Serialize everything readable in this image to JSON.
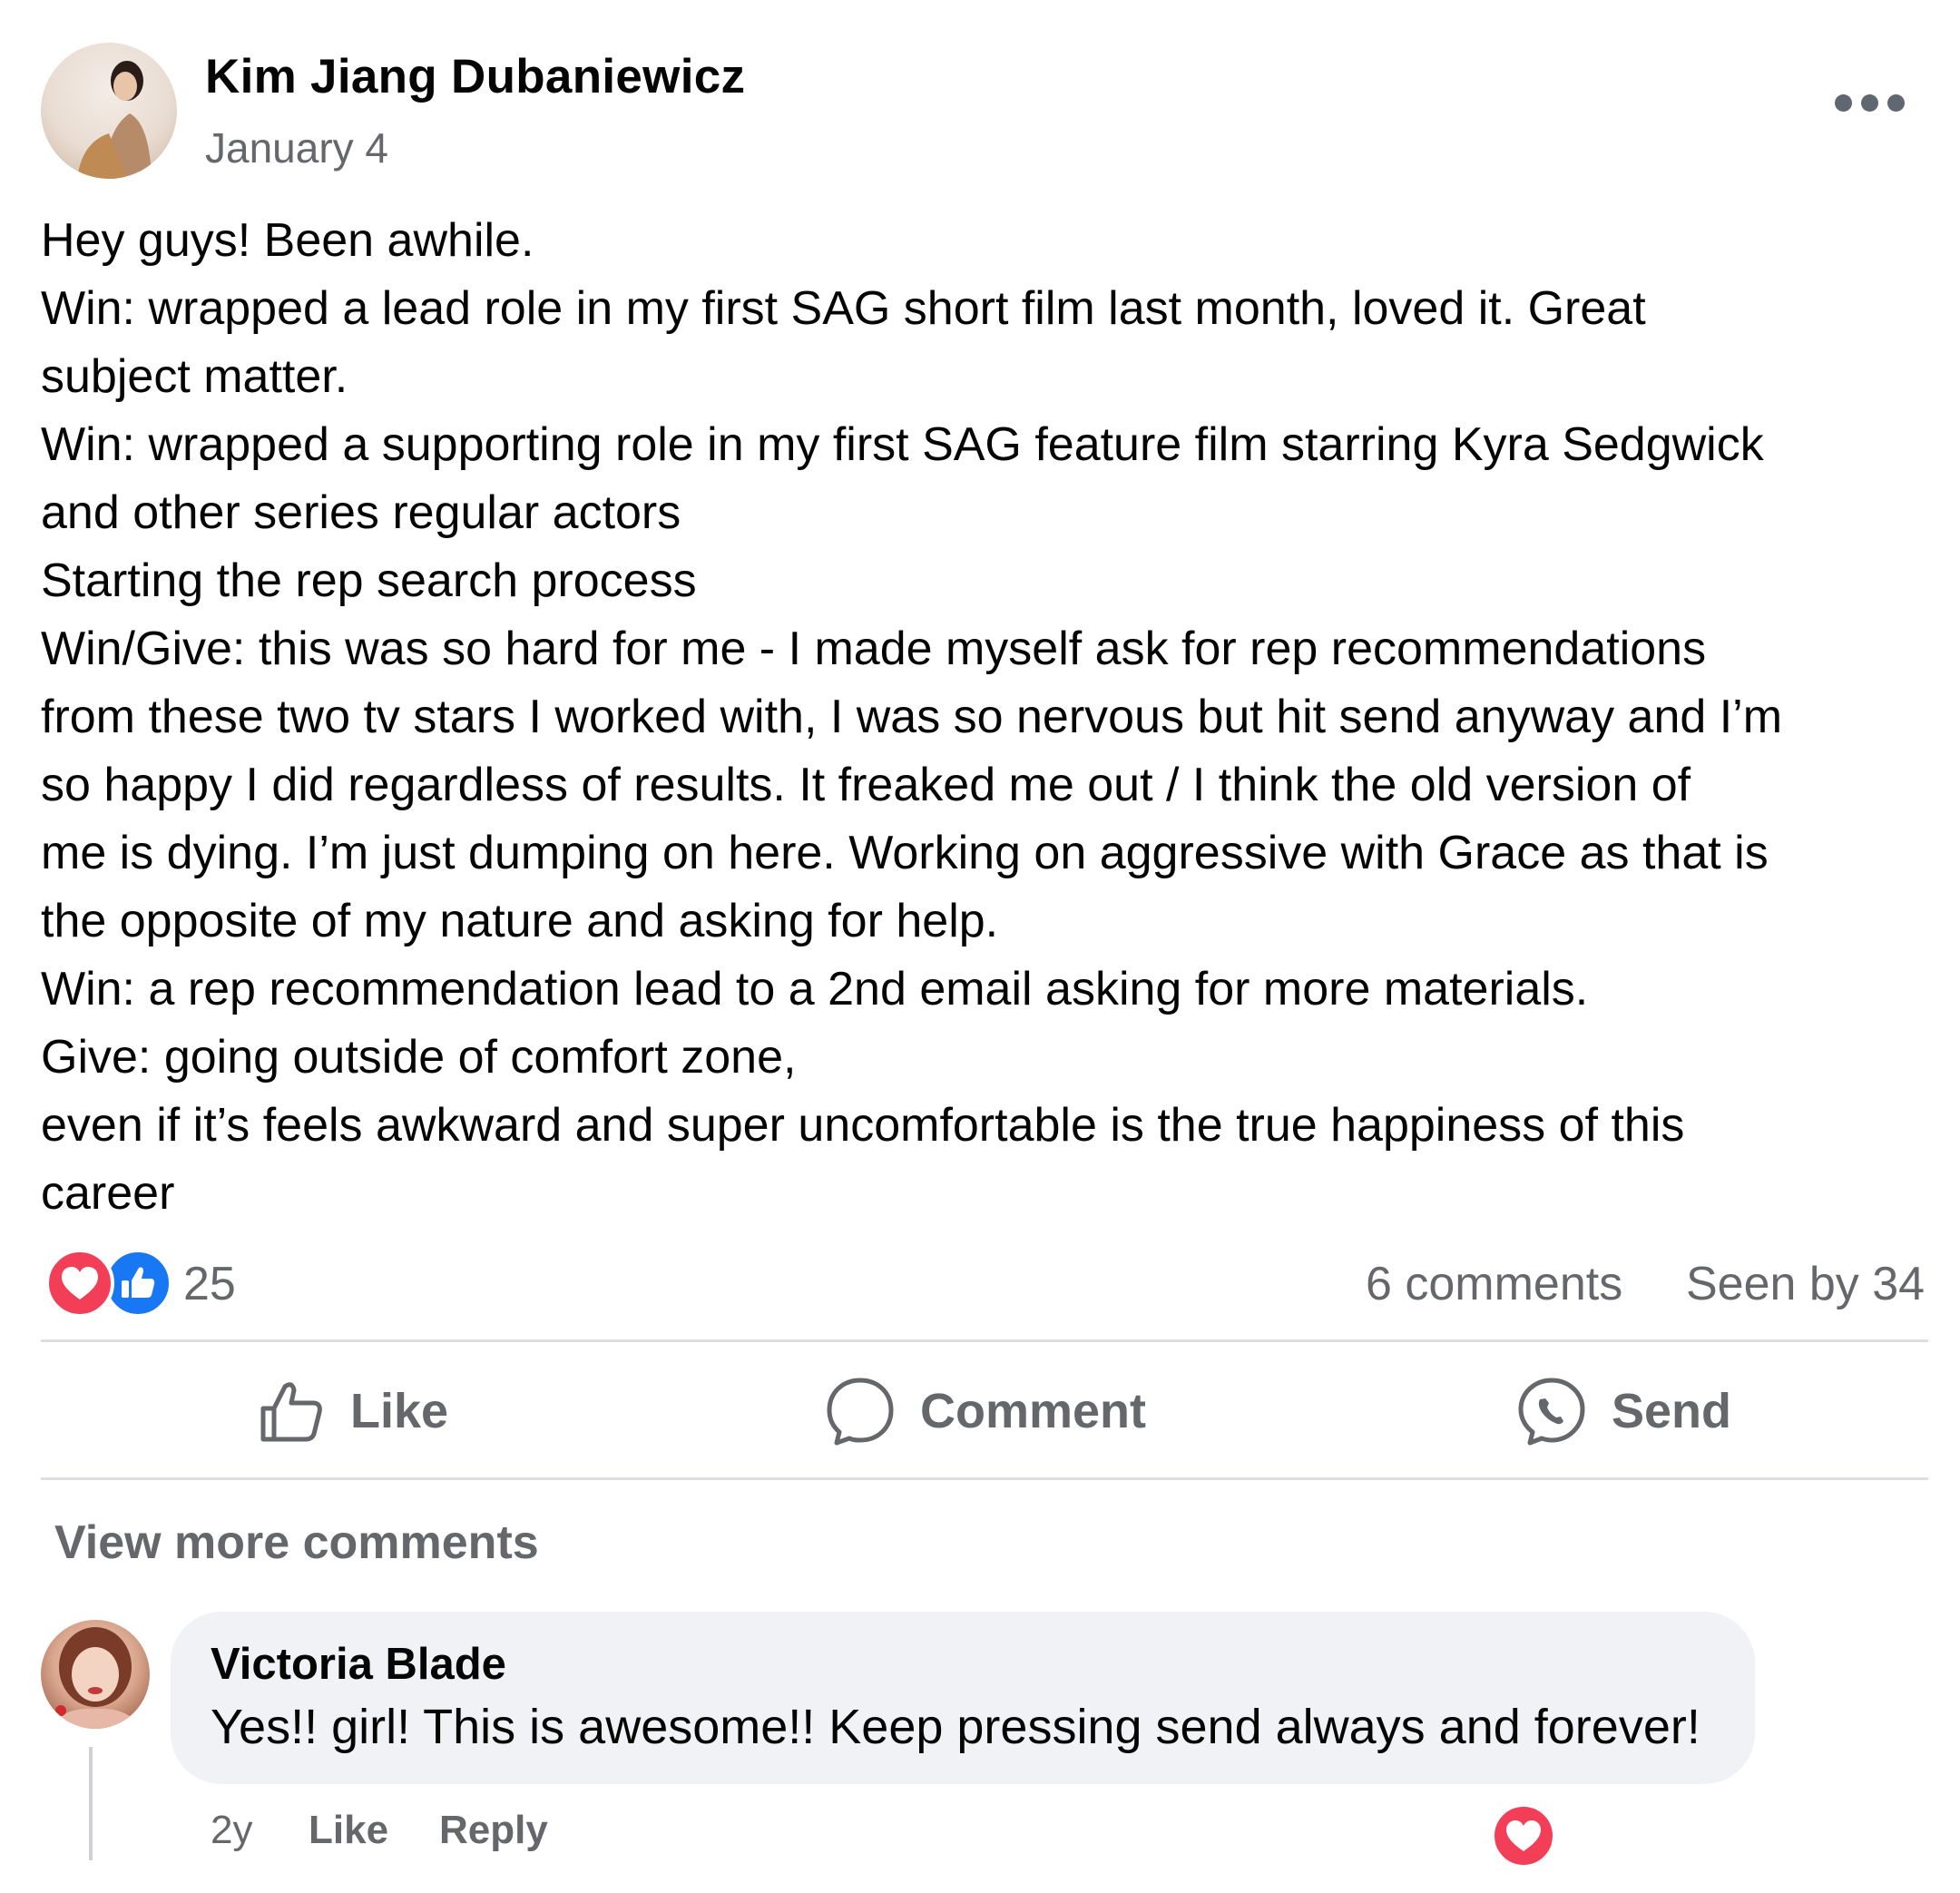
{
  "post": {
    "author": "Kim Jiang Dubaniewicz",
    "date": "January 4",
    "more_icon": "ellipsis-icon",
    "body_lines": [
      "Hey guys!   Been awhile.",
      "Win: wrapped a lead role in my first SAG short film last month, loved it. Great",
      "subject matter.",
      "Win: wrapped a supporting role in my first SAG feature film starring Kyra Sedgwick",
      "and other series regular actors",
      "Starting the rep search process",
      "Win/Give:  this was so hard for me - I made myself ask for rep recommendations",
      "from these two tv stars I worked with, I was so nervous but hit send anyway and I’m",
      "so happy I did regardless of results.  It freaked me out / I think the old version of",
      "me is dying.  I’m just dumping on here.  Working on aggressive with Grace as that is",
      "the opposite of my nature and asking for help.",
      "Win:  a rep recommendation lead to a 2nd email asking for more materials.",
      "Give:  going outside of comfort zone,",
      "even if it’s feels awkward and super uncomfortable is the true happiness of this",
      "career"
    ]
  },
  "reactions": {
    "types": [
      "heart-icon",
      "like-icon"
    ],
    "count": "25",
    "comments": "6 comments",
    "seen_by": "Seen by 34"
  },
  "actions": {
    "like": "Like",
    "comment": "Comment",
    "send": "Send"
  },
  "view_more_comments": "View more comments",
  "comment": {
    "author": "Victoria Blade",
    "text": "Yes!! girl! This is awesome!! Keep pressing send always and forever!",
    "time": "2y",
    "like": "Like",
    "reply": "Reply",
    "reaction_icon": "heart-icon"
  },
  "colors": {
    "text": "#050505",
    "secondary": "#65676b",
    "heart": "#f33e58",
    "like_blue": "#1877f2",
    "bubble": "#f0f2f5"
  }
}
